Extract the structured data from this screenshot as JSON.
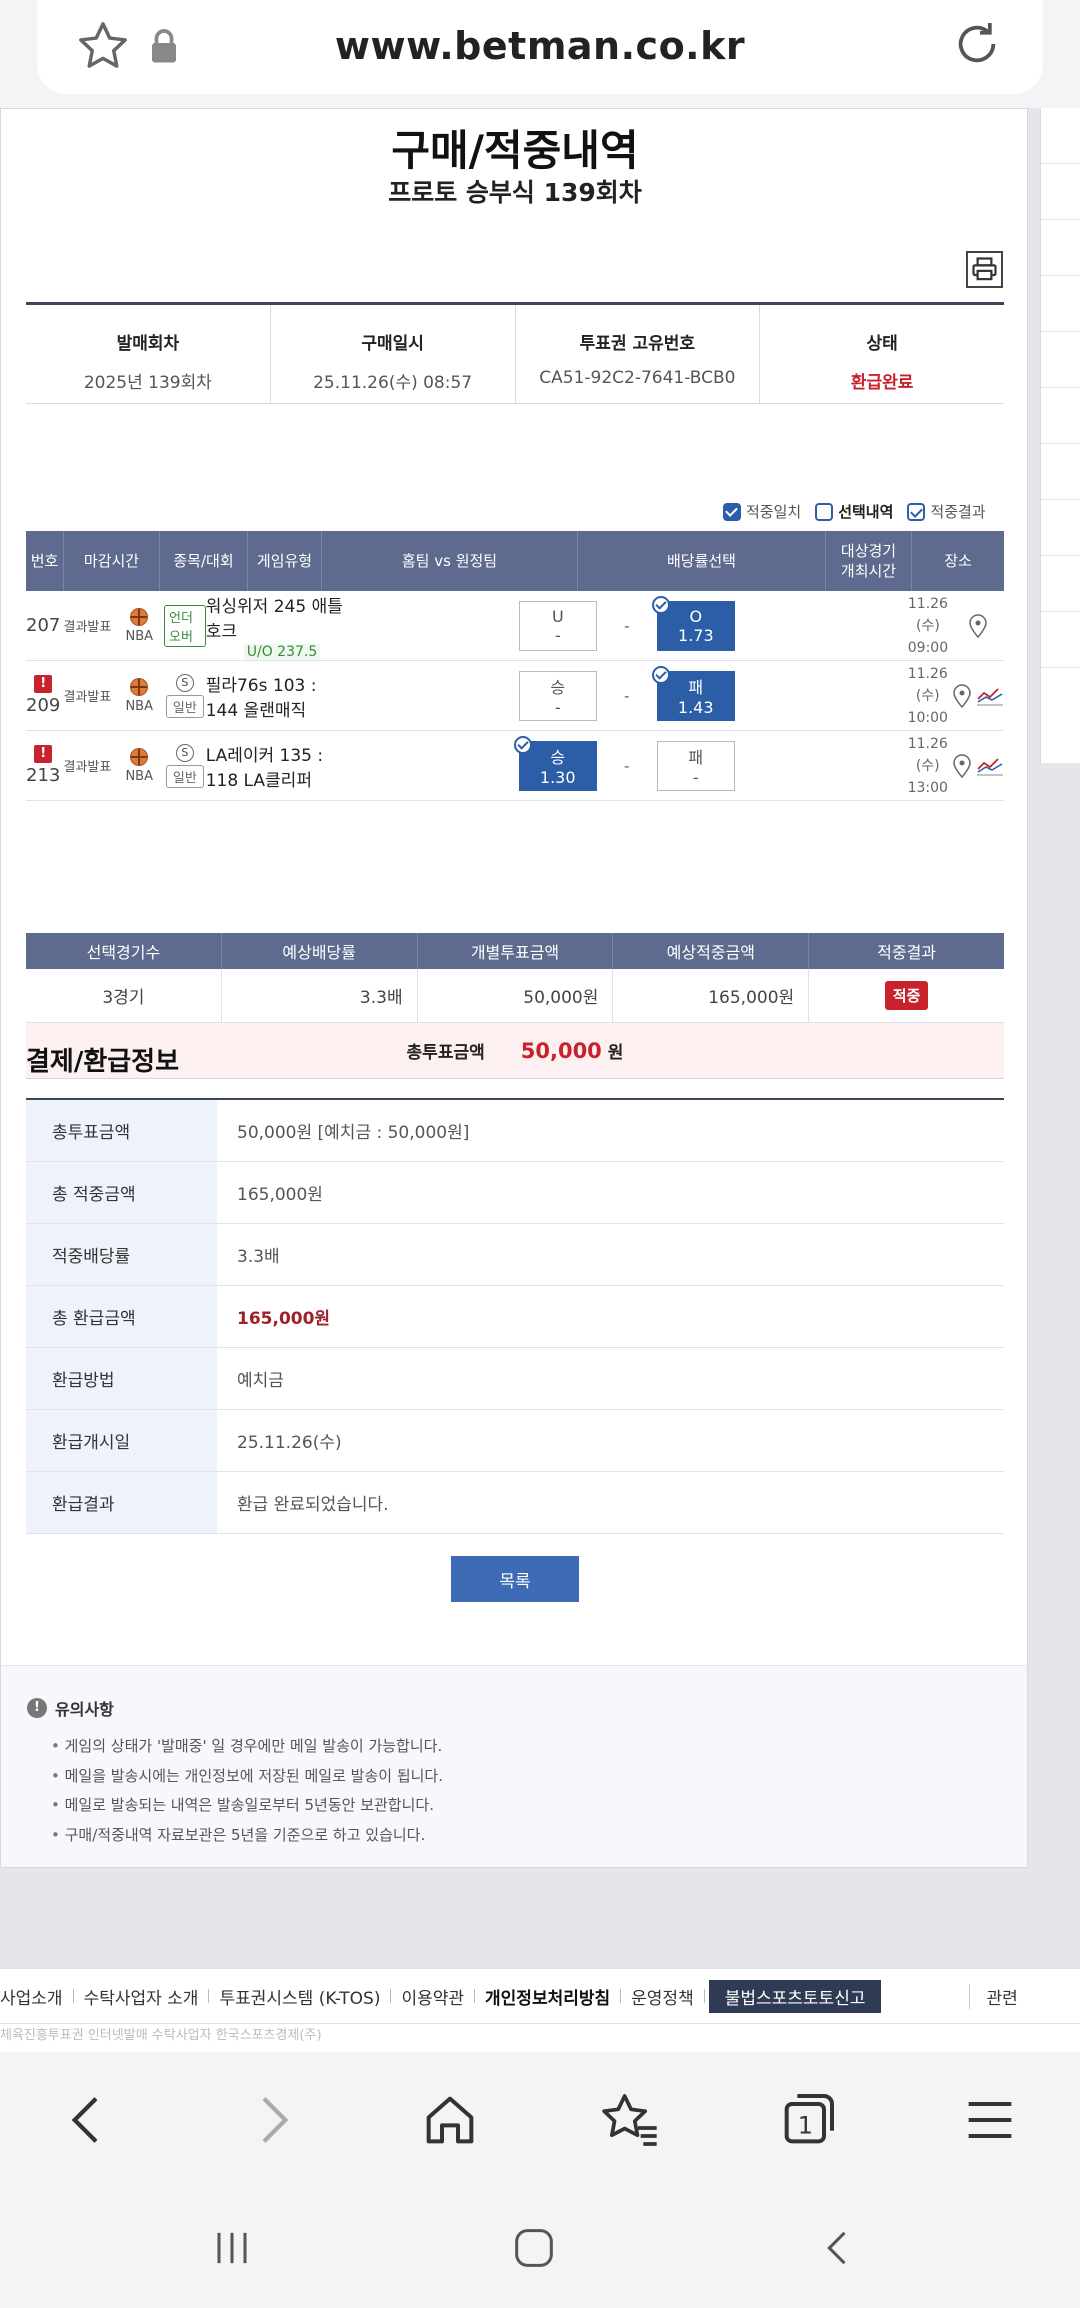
{
  "browser": {
    "url": "www.betman.co.kr",
    "tab_count": "1"
  },
  "page": {
    "title": "구매/적중내역",
    "subtitle": "프로토 승부식 139회차"
  },
  "info": {
    "round_label": "발매회차",
    "round_value": "2025년 139회차",
    "purchase_label": "구매일시",
    "purchase_value": "25.11.26(수) 08:57",
    "ticket_label": "투표권 고유번호",
    "ticket_value": "CA51-92C2-7641-BCB0",
    "status_label": "상태",
    "status_value": "환급완료"
  },
  "legend": {
    "hit": "적중일치",
    "selected": "선택내역",
    "result": "적중결과"
  },
  "games_header": {
    "no": "번호",
    "close": "마감시간",
    "sport": "종목/대회",
    "type": "게임유형",
    "match": "홈팀 vs 원정팀",
    "odds": "배당률선택",
    "date_1": "대상경기",
    "date_2": "개최시간",
    "place": "장소"
  },
  "games": [
    {
      "no": "207",
      "status": "결과발표",
      "league": "NBA",
      "type": "언더오버",
      "match": "워싱위저  245  애틀호크",
      "line": "U/O 237.5",
      "left_label": "U",
      "left_odds": "-",
      "mid": "-",
      "right_label": "O",
      "right_odds": "1.73",
      "date": "11.26 (수)",
      "time": "09:00"
    },
    {
      "no": "209",
      "status": "결과발표",
      "league": "NBA",
      "type_s": "S",
      "type": "일반",
      "match": "필라76s 103 : 144 올랜매직",
      "left_label": "승",
      "left_odds": "-",
      "mid": "-",
      "right_label": "패",
      "right_odds": "1.43",
      "date": "11.26 (수)",
      "time": "10:00"
    },
    {
      "no": "213",
      "status": "결과발표",
      "league": "NBA",
      "type_s": "S",
      "type": "일반",
      "match": "LA레이커 135 : 118 LA클리퍼",
      "left_label": "승",
      "left_odds": "1.30",
      "mid": "-",
      "right_label": "패",
      "right_odds": "-",
      "date": "11.26 (수)",
      "time": "13:00"
    }
  ],
  "summary": {
    "h_count": "선택경기수",
    "h_odds": "예상배당률",
    "h_bet": "개별투표금액",
    "h_expected": "예상적중금액",
    "h_result": "적중결과",
    "count": "3경기",
    "odds": "3.3배",
    "bet": "50,000원",
    "expected": "165,000원",
    "result": "적중",
    "total_label": "총투표금액",
    "total_amount": "50,000",
    "total_unit": "원"
  },
  "payment": {
    "title": "결제/환급정보",
    "rows": [
      {
        "k": "총투표금액",
        "v": "50,000원 [예치금 : 50,000원]"
      },
      {
        "k": "총 적중금액",
        "v": "165,000원"
      },
      {
        "k": "적중배당률",
        "v": "3.3배"
      },
      {
        "k": "총 환급금액",
        "v": "165,000원"
      },
      {
        "k": "환급방법",
        "v": "예치금"
      },
      {
        "k": "환급개시일",
        "v": "25.11.26(수)"
      },
      {
        "k": "환급결과",
        "v": "환급 완료되었습니다."
      }
    ]
  },
  "list_button": "목록",
  "notice": {
    "title": "유의사항",
    "items": [
      "게임의 상태가 '발매중' 일 경우에만 메일 발송이 가능합니다.",
      "메일을 발송시에는 개인정보에 저장된 메일로 발송이 됩니다.",
      "메일로 발송되는 내역은 발송일로부터 5년동안 보관합니다.",
      "구매/적중내역 자료보관은 5년을 기준으로 하고 있습니다."
    ]
  },
  "footer": {
    "l1": "사업소개",
    "l2": "수탁사업자 소개",
    "l3": "투표권시스템 (K-TOS)",
    "l4": "이용약관",
    "l5": "개인정보처리방침",
    "l6": "운영정책",
    "l7": "불법스포츠토토신고",
    "l8": "관련",
    "sub": "체육진흥투표권 인터넷발매 수탁사업자 한국스포츠경제(주)"
  },
  "colors": {
    "accent": "#2c5ea8",
    "header": "#5e6b8e",
    "red": "#c8232c"
  }
}
